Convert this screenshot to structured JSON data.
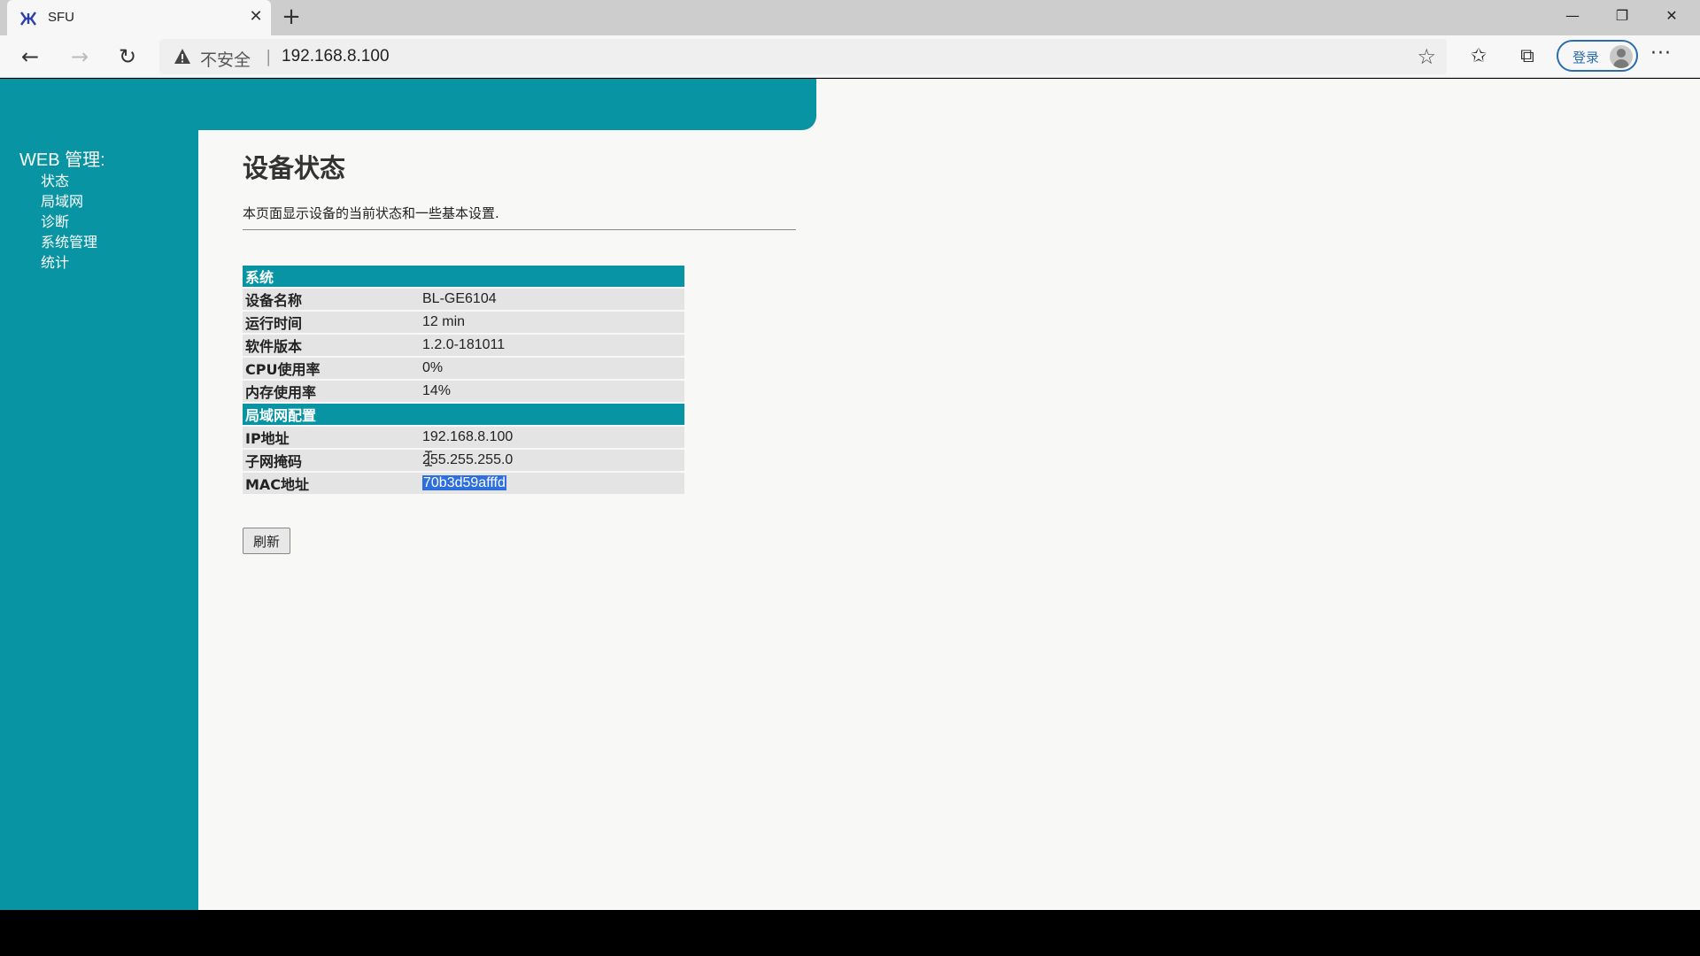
{
  "browser": {
    "tab_title": "SFU",
    "tab_close": "✕",
    "new_tab": "+",
    "security_label": "不安全",
    "separator": "|",
    "url": "192.168.8.100",
    "signin_label": "登录",
    "window": {
      "minimize": "—",
      "restore": "❐",
      "close": "✕"
    },
    "nav": {
      "back": "←",
      "forward": "→",
      "reload": "↻"
    },
    "icons": {
      "star": "☆",
      "favorites": "✩",
      "collections": "⧉",
      "more": "···"
    }
  },
  "sidebar": {
    "heading": "WEB 管理:",
    "items": [
      {
        "label": "状态"
      },
      {
        "label": "局域网"
      },
      {
        "label": "诊断"
      },
      {
        "label": "系统管理"
      },
      {
        "label": "统计"
      }
    ]
  },
  "main": {
    "title": "设备状态",
    "description": "本页面显示设备的当前状态和一些基本设置.",
    "system_section": "系统",
    "system_rows": [
      {
        "key": "设备名称",
        "value": "BL-GE6104"
      },
      {
        "key": "运行时间",
        "value": "12 min"
      },
      {
        "key": "软件版本",
        "value": "1.2.0-181011"
      },
      {
        "key": "CPU使用率",
        "value": "0%"
      },
      {
        "key": "内存使用率",
        "value": "14%"
      }
    ],
    "lan_section": "局域网配置",
    "lan_rows": [
      {
        "key": "IP地址",
        "value": "192.168.8.100"
      },
      {
        "key": "子网掩码",
        "value": "255.255.255.0"
      },
      {
        "key": "MAC地址",
        "value": "70b3d59afffd"
      }
    ],
    "refresh_label": "刷新"
  },
  "colors": {
    "accent": "#0894a3",
    "selection": "#2e6fe0"
  }
}
